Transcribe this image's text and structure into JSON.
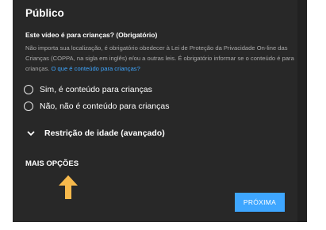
{
  "audience": {
    "title": "Público",
    "question": "Este vídeo é para crianças? (Obrigatório)",
    "description": "Não importa sua localização, é obrigatório obedecer à Lei de Proteção da Privacidade On-line das Crianças (COPPA, na sigla em inglês) e/ou a outras leis. É obrigatório informar se o conteúdo é para crianças.",
    "help_link": "O que é conteúdo para crianças?",
    "options": [
      {
        "label": "Sim, é conteúdo para crianças",
        "selected": false
      },
      {
        "label": "Não, não é conteúdo para crianças",
        "selected": false
      }
    ]
  },
  "age_restriction": {
    "label": "Restrição de idade (avançado)",
    "icon": "chevron-down-icon"
  },
  "more_options": {
    "label": "MAIS OPÇÕES"
  },
  "annotation": {
    "icon": "arrow-up-icon",
    "color": "#f6b94c"
  },
  "footer": {
    "next_label": "PRÓXIMA"
  },
  "colors": {
    "dialog_background": "#282828",
    "accent": "#3ea6ff",
    "secondary_text": "#aaaaaa"
  }
}
